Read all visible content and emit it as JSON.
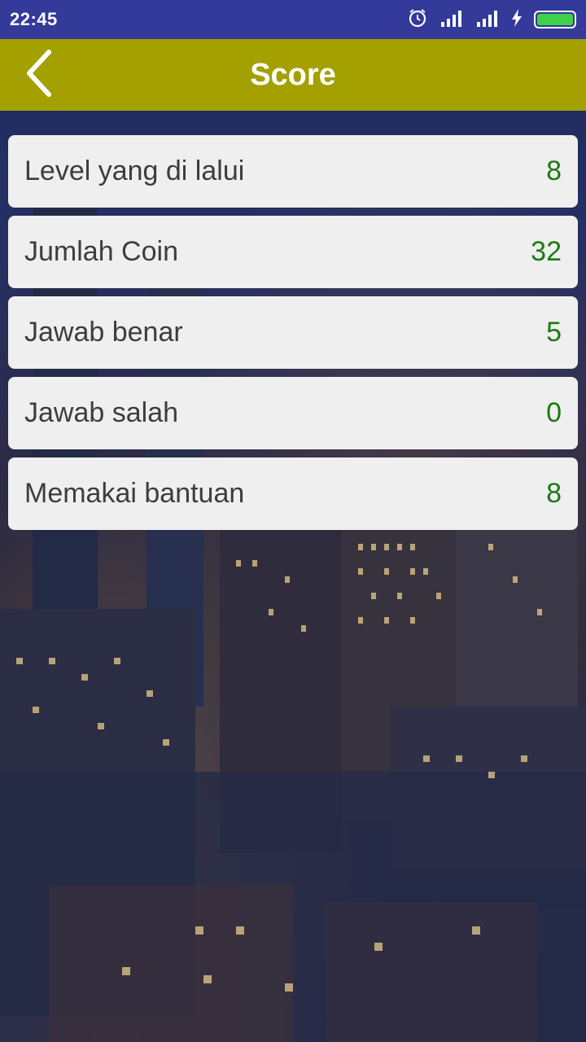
{
  "status_bar": {
    "time": "22:45",
    "icons": [
      "alarm-icon",
      "signal-icon",
      "signal-icon",
      "charging-icon",
      "battery-icon"
    ],
    "battery_color": "#3fd14a"
  },
  "toolbar": {
    "title": "Score",
    "back_icon": "chevron-left-icon",
    "background": "#a3a000"
  },
  "score": {
    "rows": [
      {
        "label": "Level yang di lalui",
        "value": "8"
      },
      {
        "label": "Jumlah Coin",
        "value": "32"
      },
      {
        "label": "Jawab benar",
        "value": "5"
      },
      {
        "label": "Jawab salah",
        "value": "0"
      },
      {
        "label": "Memakai bantuan",
        "value": "8"
      }
    ]
  },
  "colors": {
    "status_bar": "#333a99",
    "value_text": "#1c7a10"
  }
}
